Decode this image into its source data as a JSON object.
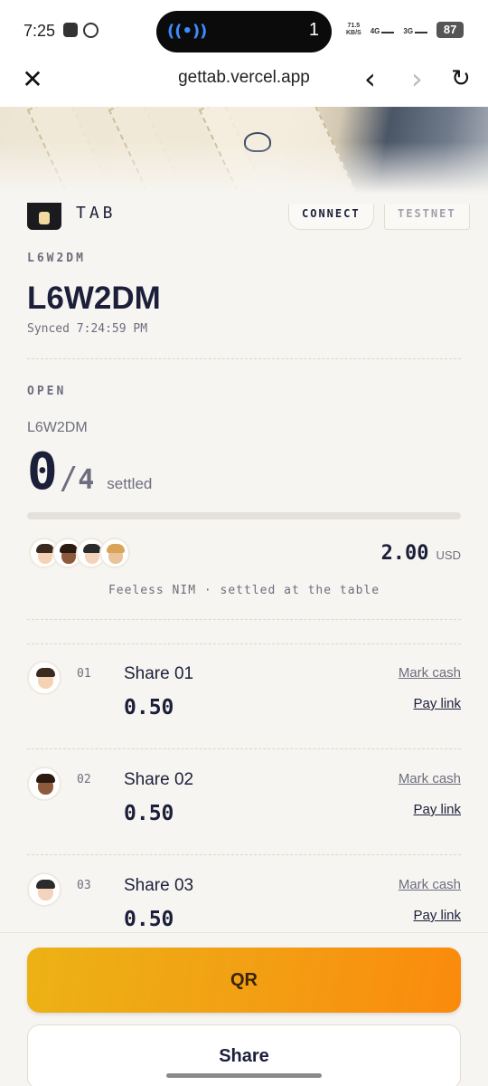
{
  "status_bar": {
    "time": "7:25",
    "island_number": "1",
    "net_speed_value": "71.5",
    "net_speed_unit": "KB/S",
    "network_1": "4G",
    "network_2": "3G",
    "battery": "87"
  },
  "browser": {
    "url": "gettab.vercel.app",
    "close_glyph": "✕",
    "back_glyph": "‹",
    "forward_glyph": "›",
    "reload_glyph": "↻"
  },
  "header": {
    "brand": "TAB",
    "connect_label": "CONNECT",
    "network_label": "TESTNET"
  },
  "tab": {
    "eyebrow_id": "L6W2DM",
    "title": "L6W2DM",
    "synced": "Synced 7:24:59 PM"
  },
  "status": {
    "label": "OPEN",
    "sub_id": "L6W2DM",
    "settled_count": "0",
    "slash": "/",
    "total_count": "4",
    "settled_word": "settled",
    "progress_fraction": 0,
    "total_amount": "2.00",
    "currency": "USD",
    "note": "Feeless NIM · settled at the table"
  },
  "participants": [
    {
      "skin": "#f6d2b4",
      "hair": "#3b2a20"
    },
    {
      "skin": "#8d5a3b",
      "hair": "#2a1a10"
    },
    {
      "skin": "#f3d3bb",
      "hair": "#2b2b2b"
    },
    {
      "skin": "#e9c39a",
      "hair": "#d9a35a"
    }
  ],
  "shares": [
    {
      "index": "01",
      "name": "Share 01",
      "amount": "0.50",
      "mark_cash": "Mark cash",
      "pay_link": "Pay link",
      "skin": "#f6d2b4",
      "hair": "#3b2a20"
    },
    {
      "index": "02",
      "name": "Share 02",
      "amount": "0.50",
      "mark_cash": "Mark cash",
      "pay_link": "Pay link",
      "skin": "#8d5a3b",
      "hair": "#2a1a10"
    },
    {
      "index": "03",
      "name": "Share 03",
      "amount": "0.50",
      "mark_cash": "Mark cash",
      "pay_link": "Pay link",
      "skin": "#f3d3bb",
      "hair": "#2b2b2b"
    }
  ],
  "actions": {
    "qr_label": "QR",
    "share_label": "Share"
  },
  "colors": {
    "accent_start": "#ecb215",
    "accent_end": "#fb8a0c",
    "ink": "#1c1f3a",
    "muted": "#6c6e7e",
    "background": "#f7f5f1"
  }
}
